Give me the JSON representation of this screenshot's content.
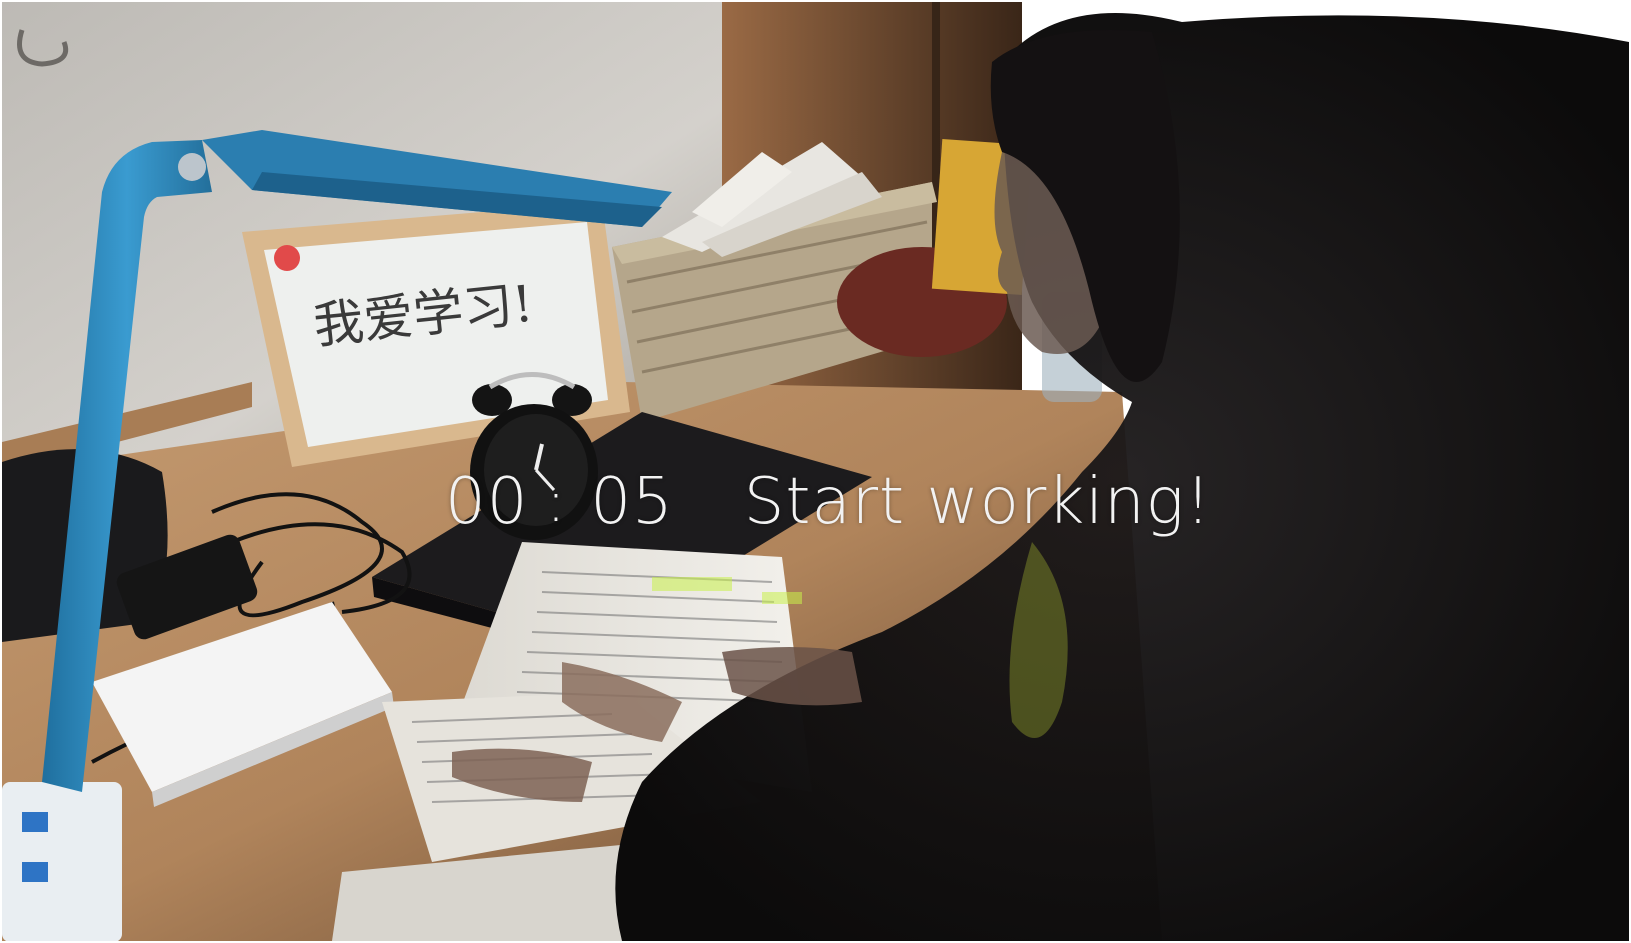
{
  "photo": {
    "whiteboard_text": "我爱学习!",
    "overlay": {
      "minutes": "00",
      "separator": ":",
      "seconds": "05",
      "message": "Start working!"
    },
    "palette": {
      "wall": "#c9c6c0",
      "desk": "#b88c62",
      "lamp": "#2f86b7",
      "dark": "#141213",
      "overlay_text": "#f2f2f2"
    }
  }
}
